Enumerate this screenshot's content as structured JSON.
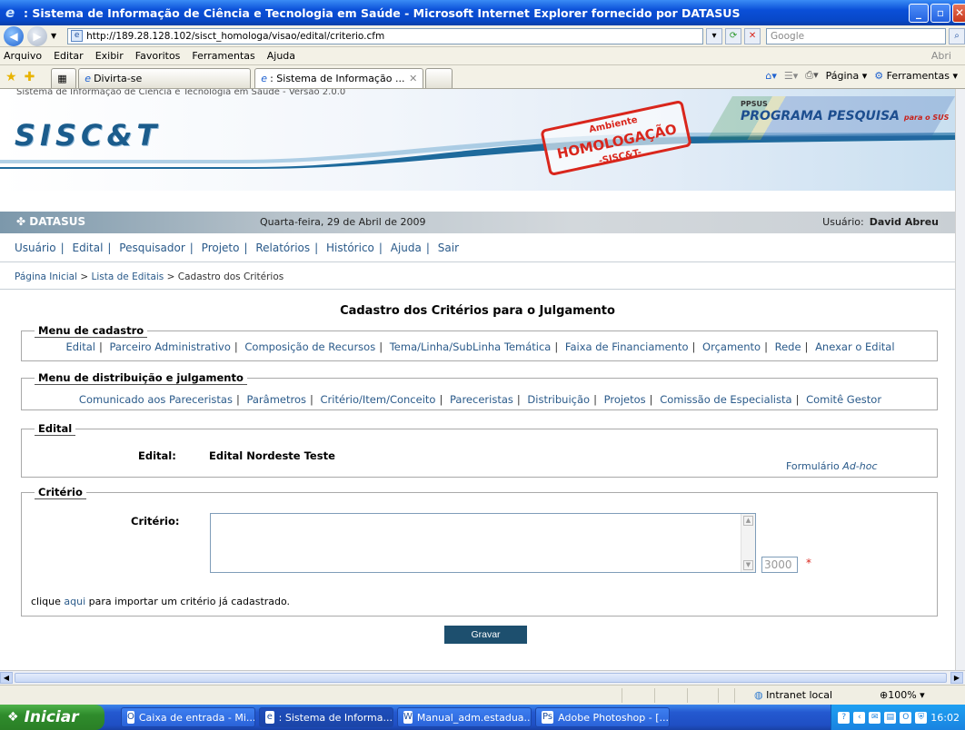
{
  "window": {
    "title": ": Sistema de Informação de Ciência e Tecnologia em Saúde - Microsoft Internet Explorer fornecido por DATASUS"
  },
  "address": {
    "url": "http://189.28.128.102/sisct_homologa/visao/edital/criterio.cfm",
    "search_placeholder": "Google"
  },
  "menu": [
    "Arquivo",
    "Editar",
    "Exibir",
    "Favoritos",
    "Ferramentas",
    "Ajuda"
  ],
  "menu_right": "Abri",
  "tabs": [
    {
      "label": "Divirta-se"
    },
    {
      "label": ": Sistema de Informação ..."
    }
  ],
  "toolbar": {
    "page_label": "Página",
    "tools_label": "Ferramentas"
  },
  "site": {
    "top_text": "Sistema de Informação de Ciência e Tecnologia em Saúde - Versão 2.0.0",
    "logo": "SISC&T",
    "stamp_main": "HOMOLOGAÇÃO",
    "stamp_top": "Ambiente",
    "stamp_sub": "-SISC&T-",
    "ppsus_tag": "PPSUS",
    "ppsus_title": "PROGRAMA PESQUISA",
    "ppsus_suffix": "para o SUS",
    "brand": "DATASUS",
    "date": "Quarta-feira, 29 de Abril de 2009",
    "user_label": "Usuário:",
    "user_name": "David Abreu"
  },
  "nav": [
    "Usuário",
    "Edital",
    "Pesquisador",
    "Projeto",
    "Relatórios",
    "Histórico",
    "Ajuda",
    "Sair"
  ],
  "breadcrumb": {
    "home": "Página Inicial",
    "list": "Lista de Editais",
    "current": "Cadastro dos Critérios",
    "sep": ">"
  },
  "page_title": "Cadastro dos Critérios para o Julgamento",
  "menu_cadastro": {
    "legend": "Menu de cadastro",
    "links": [
      "Edital",
      "Parceiro Administrativo",
      "Composição de Recursos",
      "Tema/Linha/SubLinha Temática",
      "Faixa de Financiamento",
      "Orçamento",
      "Rede",
      "Anexar o Edital"
    ]
  },
  "menu_distribuicao": {
    "legend": "Menu de distribuição e julgamento",
    "links": [
      "Comunicado aos Pareceristas",
      "Parâmetros",
      "Critério/Item/Conceito",
      "Pareceristas",
      "Distribuição",
      "Projetos",
      "Comissão de Especialista",
      "Comitê Gestor"
    ]
  },
  "edital": {
    "legend": "Edital",
    "label": "Edital:",
    "value": "Edital Nordeste Teste",
    "form_prefix": "Formulário",
    "form_italic": "Ad-hoc"
  },
  "criterio": {
    "legend": "Critério",
    "label": "Critério:",
    "counter": "3000",
    "required": "*",
    "import_pre": "clique",
    "import_link": "aqui",
    "import_post": "para importar um critério já cadastrado."
  },
  "save_label": "Gravar",
  "statusbar": {
    "zone": "Intranet local",
    "zoom": "100%"
  },
  "taskbar": {
    "start": "Iniciar",
    "items": [
      "Caixa de entrada - Mi...",
      ": Sistema de Informa...",
      "Manual_adm.estadua...",
      "Adobe Photoshop - [..."
    ],
    "clock": "16:02"
  }
}
